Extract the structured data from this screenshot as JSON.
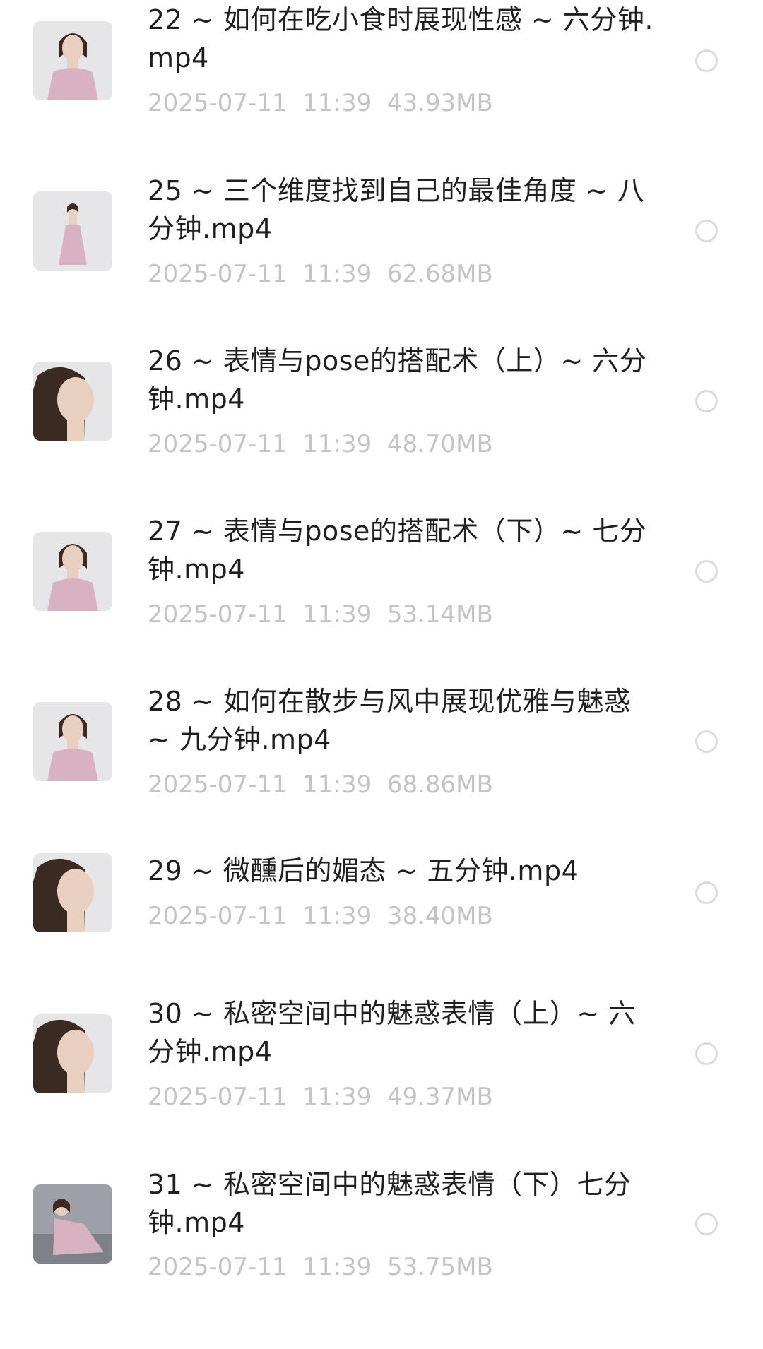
{
  "files": [
    {
      "title": "22 ~ 如何在吃小食时展现性感 ~ 六分钟.mp4",
      "date": "2025-07-11",
      "time": "11:39",
      "size": "43.93MB",
      "thumb": "portrait-half"
    },
    {
      "title": "25 ~ 三个维度找到自己的最佳角度 ~ 八分钟.mp4",
      "date": "2025-07-11",
      "time": "11:39",
      "size": "62.68MB",
      "thumb": "full-body"
    },
    {
      "title": "26 ~ 表情与pose的搭配术（上）~ 六分钟.mp4",
      "date": "2025-07-11",
      "time": "11:39",
      "size": "48.70MB",
      "thumb": "face-closeup"
    },
    {
      "title": "27 ~ 表情与pose的搭配术（下）~ 七分钟.mp4",
      "date": "2025-07-11",
      "time": "11:39",
      "size": "53.14MB",
      "thumb": "portrait-half"
    },
    {
      "title": "28 ~ 如何在散步与风中展现优雅与魅惑 ~ 九分钟.mp4",
      "date": "2025-07-11",
      "time": "11:39",
      "size": "68.86MB",
      "thumb": "portrait-half"
    },
    {
      "title": "29 ~ 微醺后的媚态 ~ 五分钟.mp4",
      "date": "2025-07-11",
      "time": "11:39",
      "size": "38.40MB",
      "thumb": "face-closeup"
    },
    {
      "title": "30 ~ 私密空间中的魅惑表情（上）~ 六分钟.mp4",
      "date": "2025-07-11",
      "time": "11:39",
      "size": "49.37MB",
      "thumb": "face-closeup"
    },
    {
      "title": "31 ~ 私密空间中的魅惑表情（下）七分钟.mp4",
      "date": "2025-07-11",
      "time": "11:39",
      "size": "53.75MB",
      "thumb": "seated"
    }
  ],
  "colors": {
    "title": "#1f1f1f",
    "meta": "#c2c4c8",
    "radio_border": "#d9dbdf",
    "thumb_bg": "#e6e6e8",
    "dress": "#d8b2c2"
  }
}
